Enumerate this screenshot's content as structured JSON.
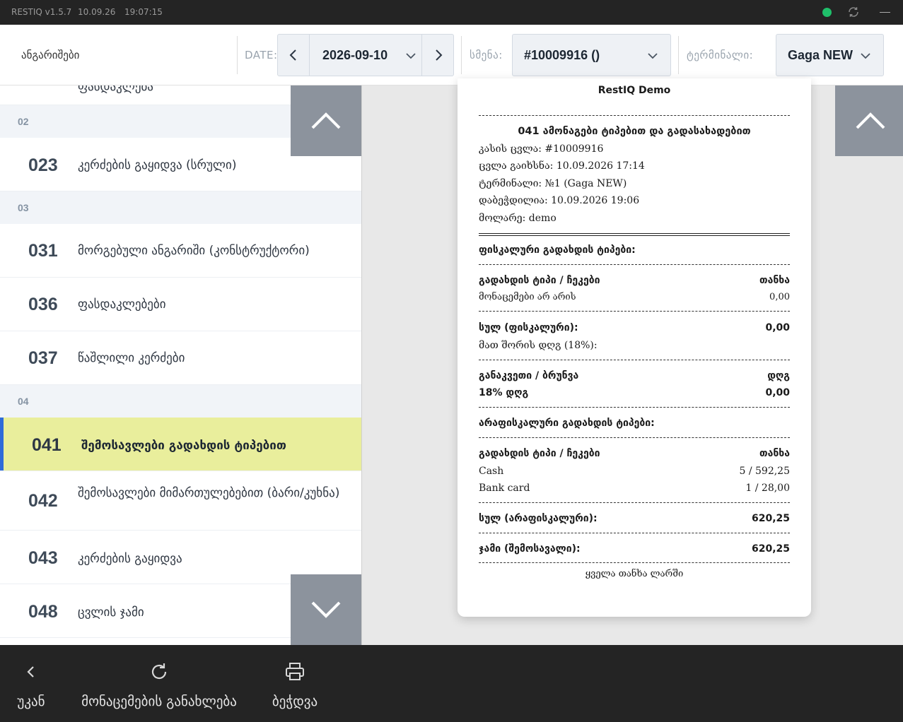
{
  "titlebar": {
    "app": "RESTIQ v1.5.7",
    "date": "10.09.26",
    "time": "19:07:15",
    "status_color": "#1fbf6a"
  },
  "header": {
    "title": "ანგარიშები",
    "date_label": "DATE:",
    "date_value": "2026-09-10",
    "shift_label": "სმენა:",
    "shift_value": "#10009916 ()",
    "terminal_label": "ტერმინალი:",
    "terminal_value": "Gaga NEW"
  },
  "list": {
    "sections": [
      {
        "code": "02"
      },
      {
        "code": "03"
      },
      {
        "code": "04"
      }
    ],
    "items": [
      {
        "code": "023",
        "label": "კერძების გაყიდვა (სრული)"
      },
      {
        "code": "031",
        "label": "მორგებული ანგარიში (კონსტრუქტორი)"
      },
      {
        "code": "036",
        "label": "ფასდაკლებები"
      },
      {
        "code": "037",
        "label": "წაშლილი კერძები"
      },
      {
        "code": "041",
        "label": "შემოსავლები გადახდის ტიპებით"
      },
      {
        "code": "042",
        "label": "შემოსავლები მიმართულებებით (ბარი/კუხნა)"
      },
      {
        "code": "043",
        "label": "კერძების გაყიდვა"
      },
      {
        "code": "048",
        "label": "ცვლის ჯამი"
      }
    ],
    "partial_label": "ფასდაკლება"
  },
  "receipt": {
    "company": "RestIQ Demo",
    "title": "041 ამონაგები ტიპებით და გადასახადებით",
    "meta": [
      "კასის ცვლა: #10009916",
      "ცვლა გაიხსნა: 10.09.2026 17:14",
      "ტერმინალი: №1 (Gaga NEW)",
      "დაბეჭდილია: 10.09.2026 19:06",
      "მოლარე: demo"
    ],
    "fiscal_heading": "ფისკალური გადახდის ტიპები:",
    "col_type": "გადახდის ტიპი / ჩეკები",
    "col_amount": "თანხა",
    "no_data": "მონაცემები არ არის",
    "no_data_value": "0,00",
    "fiscal_total_label": "სულ (ფისკალური):",
    "fiscal_total_value": "0,00",
    "vat_incl": "მათ შორის დღგ (18%):",
    "cut_label": "განაკვეთი / ბრუნვა",
    "cut_value_label": "დღგ",
    "vat_rate": "18% დღგ",
    "vat_rate_value": "0,00",
    "nonfiscal_heading": "არაფისკალური გადახდის ტიპები:",
    "payments": [
      {
        "name": "Cash",
        "value": "5 / 592,25"
      },
      {
        "name": "Bank card",
        "value": "1 / 28,00"
      }
    ],
    "nonfiscal_total_label": "სულ (არაფისკალური):",
    "nonfiscal_total_value": "620,25",
    "grand_total_label": "ჯამი (შემოსავალი):",
    "grand_total_value": "620,25",
    "footer": "ყველა თანხა ლარში"
  },
  "bottom": {
    "back": "უკან",
    "refresh": "მონაცემების განახლება",
    "print": "ბეჭდვა"
  }
}
